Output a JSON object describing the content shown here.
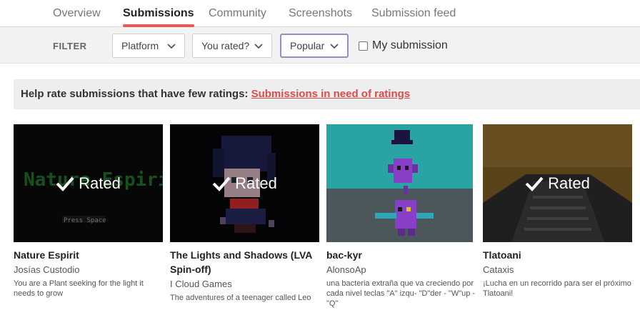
{
  "tabs": [
    {
      "label": "Overview"
    },
    {
      "label": "Submissions"
    },
    {
      "label": "Community"
    },
    {
      "label": "Screenshots"
    },
    {
      "label": "Submission feed"
    }
  ],
  "filter": {
    "label": "FILTER",
    "platform": "Platform",
    "rated": "You rated?",
    "sort": "Popular",
    "my_submission": "My submission"
  },
  "banner": {
    "text": "Help rate submissions that have few ratings: ",
    "link": "Submissions in need of ratings"
  },
  "cards": [
    {
      "title": "Nature Espirit",
      "author": "Josías Custodio",
      "desc": "You are a Plant seeking for the light it needs to grow",
      "badge": "Rated",
      "thumb_text": "Nature Espirit",
      "thumb_sub": "Press Space"
    },
    {
      "title": "The Lights and Shadows (LVA Spin-off)",
      "author": "I Cloud Games",
      "desc": "The adventures of a teenager called Leo",
      "badge": "Rated"
    },
    {
      "title": "bac-kyr",
      "author": "AlonsoAp",
      "desc": "una bacteria extraña que va creciendo por cada nivel teclas \"A\" izqu- \"D\"der - \"W\"up - \"Q\""
    },
    {
      "title": "Tlatoani",
      "author": "Cataxis",
      "desc": "¡Lucha en un recorrido para ser el próximo Tlatoani!",
      "badge": "Rated"
    }
  ],
  "colors": {
    "accent": "#e85a5a",
    "link": "#da4c4c",
    "active_select": "#9a8ad0"
  }
}
